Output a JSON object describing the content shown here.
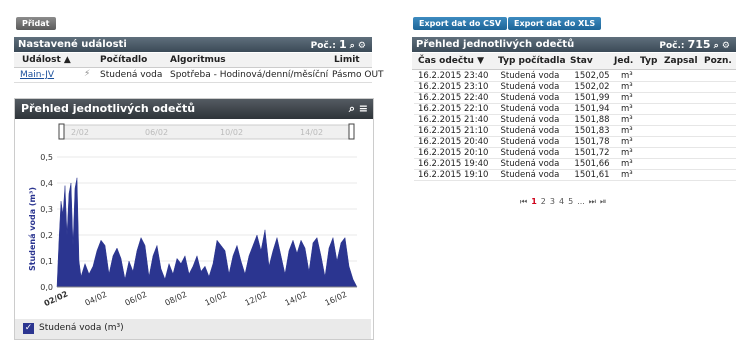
{
  "left": {
    "add_button": "Přidat",
    "events_panel": {
      "title": "Nastavené události",
      "count_label": "Poč.:",
      "count_value": "1",
      "columns": [
        "Událost ▲",
        "Počítadlo",
        "Algoritmus",
        "Limit"
      ],
      "row": {
        "event": "Main-JV",
        "meter": "Studená voda",
        "algorithm": "Spotřeba - Hodinová/denní/měsíční",
        "limit": "Pásmo OUT"
      }
    }
  },
  "chart_panel": {
    "title": "Přehled jednotlivých odečtů",
    "legend_label": "Studená voda (m³)",
    "navigator_labels": [
      "2/02",
      "06/02",
      "10/02",
      "14/02"
    ]
  },
  "chart_data": {
    "type": "area",
    "title": "",
    "ylabel": "Studená voda (m³)",
    "xlabel": "",
    "ylim": [
      0,
      0.5
    ],
    "yticks": [
      "0,0",
      "0,1",
      "0,2",
      "0,3",
      "0,4",
      "0,5"
    ],
    "xticks": [
      "02/02",
      "04/02",
      "06/02",
      "08/02",
      "10/02",
      "12/02",
      "14/02",
      "16/02"
    ],
    "x_start_day": 2,
    "x_end_day": 17,
    "series": [
      {
        "name": "Studená voda (m³)",
        "color": "#2b3590",
        "points": [
          [
            2.0,
            0.0
          ],
          [
            2.1,
            0.18
          ],
          [
            2.2,
            0.33
          ],
          [
            2.3,
            0.28
          ],
          [
            2.4,
            0.39
          ],
          [
            2.5,
            0.2
          ],
          [
            2.6,
            0.36
          ],
          [
            2.7,
            0.4
          ],
          [
            2.8,
            0.16
          ],
          [
            2.9,
            0.38
          ],
          [
            3.0,
            0.42
          ],
          [
            3.1,
            0.1
          ],
          [
            3.2,
            0.04
          ],
          [
            3.4,
            0.09
          ],
          [
            3.6,
            0.05
          ],
          [
            3.8,
            0.08
          ],
          [
            4.0,
            0.14
          ],
          [
            4.2,
            0.18
          ],
          [
            4.4,
            0.16
          ],
          [
            4.6,
            0.05
          ],
          [
            4.8,
            0.12
          ],
          [
            5.0,
            0.15
          ],
          [
            5.2,
            0.11
          ],
          [
            5.4,
            0.03
          ],
          [
            5.6,
            0.1
          ],
          [
            5.8,
            0.06
          ],
          [
            6.0,
            0.14
          ],
          [
            6.2,
            0.19
          ],
          [
            6.4,
            0.16
          ],
          [
            6.6,
            0.04
          ],
          [
            6.8,
            0.12
          ],
          [
            7.0,
            0.16
          ],
          [
            7.2,
            0.07
          ],
          [
            7.4,
            0.03
          ],
          [
            7.6,
            0.09
          ],
          [
            7.8,
            0.05
          ],
          [
            8.0,
            0.11
          ],
          [
            8.2,
            0.09
          ],
          [
            8.4,
            0.12
          ],
          [
            8.6,
            0.05
          ],
          [
            8.8,
            0.08
          ],
          [
            9.0,
            0.12
          ],
          [
            9.2,
            0.06
          ],
          [
            9.4,
            0.08
          ],
          [
            9.6,
            0.04
          ],
          [
            9.8,
            0.09
          ],
          [
            10.0,
            0.18
          ],
          [
            10.2,
            0.16
          ],
          [
            10.4,
            0.14
          ],
          [
            10.6,
            0.05
          ],
          [
            10.8,
            0.12
          ],
          [
            11.0,
            0.16
          ],
          [
            11.2,
            0.1
          ],
          [
            11.4,
            0.05
          ],
          [
            11.6,
            0.12
          ],
          [
            11.8,
            0.16
          ],
          [
            12.0,
            0.2
          ],
          [
            12.2,
            0.14
          ],
          [
            12.4,
            0.22
          ],
          [
            12.6,
            0.08
          ],
          [
            12.8,
            0.14
          ],
          [
            13.0,
            0.19
          ],
          [
            13.2,
            0.12
          ],
          [
            13.4,
            0.05
          ],
          [
            13.6,
            0.14
          ],
          [
            13.8,
            0.18
          ],
          [
            14.0,
            0.13
          ],
          [
            14.2,
            0.18
          ],
          [
            14.4,
            0.15
          ],
          [
            14.6,
            0.06
          ],
          [
            14.8,
            0.17
          ],
          [
            15.0,
            0.19
          ],
          [
            15.2,
            0.12
          ],
          [
            15.4,
            0.04
          ],
          [
            15.6,
            0.15
          ],
          [
            15.8,
            0.19
          ],
          [
            16.0,
            0.1
          ],
          [
            16.2,
            0.17
          ],
          [
            16.4,
            0.19
          ],
          [
            16.6,
            0.08
          ],
          [
            16.8,
            0.03
          ],
          [
            17.0,
            0.0
          ]
        ]
      }
    ],
    "grid": true,
    "legend_position": "bottom-left"
  },
  "right": {
    "export_csv": "Export dat do CSV",
    "export_xls": "Export dat do XLS",
    "readings_panel": {
      "title": "Přehled jednotlivých odečtů",
      "count_label": "Poč.:",
      "count_value": "715",
      "columns": [
        "Čas odečtu ▼",
        "Typ počítadla",
        "Stav",
        "Jed.",
        "Typ",
        "Zapsal",
        "Pozn."
      ],
      "rows": [
        [
          "16.2.2015 23:40",
          "Studená voda",
          "1502,05",
          "m³"
        ],
        [
          "16.2.2015 23:10",
          "Studená voda",
          "1502,02",
          "m³"
        ],
        [
          "16.2.2015 22:40",
          "Studená voda",
          "1501,99",
          "m³"
        ],
        [
          "16.2.2015 22:10",
          "Studená voda",
          "1501,94",
          "m³"
        ],
        [
          "16.2.2015 21:40",
          "Studená voda",
          "1501,88",
          "m³"
        ],
        [
          "16.2.2015 21:10",
          "Studená voda",
          "1501,83",
          "m³"
        ],
        [
          "16.2.2015 20:40",
          "Studená voda",
          "1501,78",
          "m³"
        ],
        [
          "16.2.2015 20:10",
          "Studená voda",
          "1501,72",
          "m³"
        ],
        [
          "16.2.2015 19:40",
          "Studená voda",
          "1501,66",
          "m³"
        ],
        [
          "16.2.2015 19:10",
          "Studená voda",
          "1501,61",
          "m³"
        ]
      ],
      "pagination": [
        "1",
        "2",
        "3",
        "4",
        "5",
        "..."
      ]
    }
  }
}
